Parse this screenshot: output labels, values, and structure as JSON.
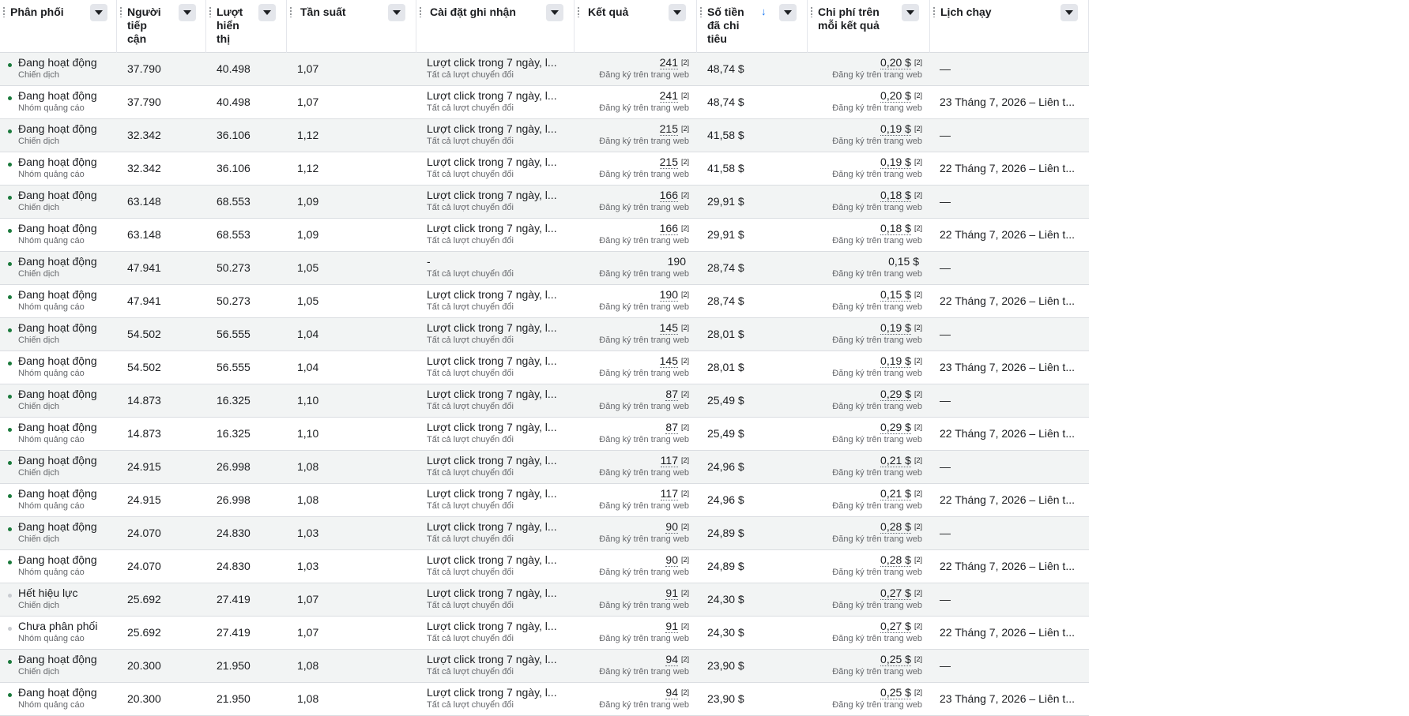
{
  "columns": [
    {
      "key": "status",
      "label": "Phân phối"
    },
    {
      "key": "reach",
      "label": "Người tiếp cận"
    },
    {
      "key": "impressions",
      "label": "Lượt hiển thị"
    },
    {
      "key": "frequency",
      "label": "Tần suất"
    },
    {
      "key": "attribution",
      "label": "Cài đặt ghi nhận"
    },
    {
      "key": "results",
      "label": "Kết quả"
    },
    {
      "key": "spent",
      "label": "Số tiền đã chi tiêu"
    },
    {
      "key": "cost_per_result",
      "label": "Chi phí trên mỗi kết quả"
    },
    {
      "key": "schedule",
      "label": "Lịch chạy"
    }
  ],
  "sort": {
    "column": "spent",
    "direction": "descending"
  },
  "colors": {
    "active_dot": "#1b7a3c",
    "inactive_dot": "#c9ccd1",
    "sort_arrow": "#1877f2",
    "row_alt": "#f2f4f4"
  },
  "rows": [
    {
      "status": "Đang hoạt động",
      "level": "Chiến dịch",
      "active": true,
      "reach": "37.790",
      "impressions": "40.498",
      "frequency": "1,07",
      "attribution": "Lượt click trong 7 ngày, l...",
      "attribution_sub": "Tất cả lượt chuyển đổi",
      "results": "241",
      "results_note": "[2]",
      "results_sub": "Đăng ký trên trang web",
      "spent": "48,74 $",
      "cpr": "0,20 $",
      "cpr_note": "[2]",
      "cpr_sub": "Đăng ký trên trang web",
      "schedule": "—"
    },
    {
      "status": "Đang hoạt động",
      "level": "Nhóm quảng cáo",
      "active": true,
      "reach": "37.790",
      "impressions": "40.498",
      "frequency": "1,07",
      "attribution": "Lượt click trong 7 ngày, l...",
      "attribution_sub": "Tất cả lượt chuyển đổi",
      "results": "241",
      "results_note": "[2]",
      "results_sub": "Đăng ký trên trang web",
      "spent": "48,74 $",
      "cpr": "0,20 $",
      "cpr_note": "[2]",
      "cpr_sub": "Đăng ký trên trang web",
      "schedule": "23 Tháng 7, 2026 – Liên t..."
    },
    {
      "status": "Đang hoạt động",
      "level": "Chiến dịch",
      "active": true,
      "reach": "32.342",
      "impressions": "36.106",
      "frequency": "1,12",
      "attribution": "Lượt click trong 7 ngày, l...",
      "attribution_sub": "Tất cả lượt chuyển đổi",
      "results": "215",
      "results_note": "[2]",
      "results_sub": "Đăng ký trên trang web",
      "spent": "41,58 $",
      "cpr": "0,19 $",
      "cpr_note": "[2]",
      "cpr_sub": "Đăng ký trên trang web",
      "schedule": "—"
    },
    {
      "status": "Đang hoạt động",
      "level": "Nhóm quảng cáo",
      "active": true,
      "reach": "32.342",
      "impressions": "36.106",
      "frequency": "1,12",
      "attribution": "Lượt click trong 7 ngày, l...",
      "attribution_sub": "Tất cả lượt chuyển đổi",
      "results": "215",
      "results_note": "[2]",
      "results_sub": "Đăng ký trên trang web",
      "spent": "41,58 $",
      "cpr": "0,19 $",
      "cpr_note": "[2]",
      "cpr_sub": "Đăng ký trên trang web",
      "schedule": "22 Tháng 7, 2026 – Liên t..."
    },
    {
      "status": "Đang hoạt động",
      "level": "Chiến dịch",
      "active": true,
      "reach": "63.148",
      "impressions": "68.553",
      "frequency": "1,09",
      "attribution": "Lượt click trong 7 ngày, l...",
      "attribution_sub": "Tất cả lượt chuyển đổi",
      "results": "166",
      "results_note": "[2]",
      "results_sub": "Đăng ký trên trang web",
      "spent": "29,91 $",
      "cpr": "0,18 $",
      "cpr_note": "[2]",
      "cpr_sub": "Đăng ký trên trang web",
      "schedule": "—"
    },
    {
      "status": "Đang hoạt động",
      "level": "Nhóm quảng cáo",
      "active": true,
      "reach": "63.148",
      "impressions": "68.553",
      "frequency": "1,09",
      "attribution": "Lượt click trong 7 ngày, l...",
      "attribution_sub": "Tất cả lượt chuyển đổi",
      "results": "166",
      "results_note": "[2]",
      "results_sub": "Đăng ký trên trang web",
      "spent": "29,91 $",
      "cpr": "0,18 $",
      "cpr_note": "[2]",
      "cpr_sub": "Đăng ký trên trang web",
      "schedule": "22 Tháng 7, 2026 – Liên t..."
    },
    {
      "status": "Đang hoạt động",
      "level": "Chiến dịch",
      "active": true,
      "reach": "47.941",
      "impressions": "50.273",
      "frequency": "1,05",
      "attribution": "-",
      "attribution_sub": "Tất cả lượt chuyển đổi",
      "results": "190",
      "results_note": "",
      "results_sub": "Đăng ký trên trang web",
      "spent": "28,74 $",
      "cpr": "0,15 $",
      "cpr_note": "",
      "cpr_sub": "Đăng ký trên trang web",
      "schedule": "—"
    },
    {
      "status": "Đang hoạt động",
      "level": "Nhóm quảng cáo",
      "active": true,
      "reach": "47.941",
      "impressions": "50.273",
      "frequency": "1,05",
      "attribution": "Lượt click trong 7 ngày, l...",
      "attribution_sub": "Tất cả lượt chuyển đổi",
      "results": "190",
      "results_note": "[2]",
      "results_sub": "Đăng ký trên trang web",
      "spent": "28,74 $",
      "cpr": "0,15 $",
      "cpr_note": "[2]",
      "cpr_sub": "Đăng ký trên trang web",
      "schedule": "22 Tháng 7, 2026 – Liên t..."
    },
    {
      "status": "Đang hoạt động",
      "level": "Chiến dịch",
      "active": true,
      "reach": "54.502",
      "impressions": "56.555",
      "frequency": "1,04",
      "attribution": "Lượt click trong 7 ngày, l...",
      "attribution_sub": "Tất cả lượt chuyển đổi",
      "results": "145",
      "results_note": "[2]",
      "results_sub": "Đăng ký trên trang web",
      "spent": "28,01 $",
      "cpr": "0,19 $",
      "cpr_note": "[2]",
      "cpr_sub": "Đăng ký trên trang web",
      "schedule": "—"
    },
    {
      "status": "Đang hoạt động",
      "level": "Nhóm quảng cáo",
      "active": true,
      "reach": "54.502",
      "impressions": "56.555",
      "frequency": "1,04",
      "attribution": "Lượt click trong 7 ngày, l...",
      "attribution_sub": "Tất cả lượt chuyển đổi",
      "results": "145",
      "results_note": "[2]",
      "results_sub": "Đăng ký trên trang web",
      "spent": "28,01 $",
      "cpr": "0,19 $",
      "cpr_note": "[2]",
      "cpr_sub": "Đăng ký trên trang web",
      "schedule": "23 Tháng 7, 2026 – Liên t..."
    },
    {
      "status": "Đang hoạt động",
      "level": "Chiến dịch",
      "active": true,
      "reach": "14.873",
      "impressions": "16.325",
      "frequency": "1,10",
      "attribution": "Lượt click trong 7 ngày, l...",
      "attribution_sub": "Tất cả lượt chuyển đổi",
      "results": "87",
      "results_note": "[2]",
      "results_sub": "Đăng ký trên trang web",
      "spent": "25,49 $",
      "cpr": "0,29 $",
      "cpr_note": "[2]",
      "cpr_sub": "Đăng ký trên trang web",
      "schedule": "—"
    },
    {
      "status": "Đang hoạt động",
      "level": "Nhóm quảng cáo",
      "active": true,
      "reach": "14.873",
      "impressions": "16.325",
      "frequency": "1,10",
      "attribution": "Lượt click trong 7 ngày, l...",
      "attribution_sub": "Tất cả lượt chuyển đổi",
      "results": "87",
      "results_note": "[2]",
      "results_sub": "Đăng ký trên trang web",
      "spent": "25,49 $",
      "cpr": "0,29 $",
      "cpr_note": "[2]",
      "cpr_sub": "Đăng ký trên trang web",
      "schedule": "22 Tháng 7, 2026 – Liên t..."
    },
    {
      "status": "Đang hoạt động",
      "level": "Chiến dịch",
      "active": true,
      "reach": "24.915",
      "impressions": "26.998",
      "frequency": "1,08",
      "attribution": "Lượt click trong 7 ngày, l...",
      "attribution_sub": "Tất cả lượt chuyển đổi",
      "results": "117",
      "results_note": "[2]",
      "results_sub": "Đăng ký trên trang web",
      "spent": "24,96 $",
      "cpr": "0,21 $",
      "cpr_note": "[2]",
      "cpr_sub": "Đăng ký trên trang web",
      "schedule": "—"
    },
    {
      "status": "Đang hoạt động",
      "level": "Nhóm quảng cáo",
      "active": true,
      "reach": "24.915",
      "impressions": "26.998",
      "frequency": "1,08",
      "attribution": "Lượt click trong 7 ngày, l...",
      "attribution_sub": "Tất cả lượt chuyển đổi",
      "results": "117",
      "results_note": "[2]",
      "results_sub": "Đăng ký trên trang web",
      "spent": "24,96 $",
      "cpr": "0,21 $",
      "cpr_note": "[2]",
      "cpr_sub": "Đăng ký trên trang web",
      "schedule": "22 Tháng 7, 2026 – Liên t..."
    },
    {
      "status": "Đang hoạt động",
      "level": "Chiến dịch",
      "active": true,
      "reach": "24.070",
      "impressions": "24.830",
      "frequency": "1,03",
      "attribution": "Lượt click trong 7 ngày, l...",
      "attribution_sub": "Tất cả lượt chuyển đổi",
      "results": "90",
      "results_note": "[2]",
      "results_sub": "Đăng ký trên trang web",
      "spent": "24,89 $",
      "cpr": "0,28 $",
      "cpr_note": "[2]",
      "cpr_sub": "Đăng ký trên trang web",
      "schedule": "—"
    },
    {
      "status": "Đang hoạt động",
      "level": "Nhóm quảng cáo",
      "active": true,
      "reach": "24.070",
      "impressions": "24.830",
      "frequency": "1,03",
      "attribution": "Lượt click trong 7 ngày, l...",
      "attribution_sub": "Tất cả lượt chuyển đổi",
      "results": "90",
      "results_note": "[2]",
      "results_sub": "Đăng ký trên trang web",
      "spent": "24,89 $",
      "cpr": "0,28 $",
      "cpr_note": "[2]",
      "cpr_sub": "Đăng ký trên trang web",
      "schedule": "22 Tháng 7, 2026 – Liên t..."
    },
    {
      "status": "Hết hiệu lực",
      "level": "Chiến dịch",
      "active": false,
      "reach": "25.692",
      "impressions": "27.419",
      "frequency": "1,07",
      "attribution": "Lượt click trong 7 ngày, l...",
      "attribution_sub": "Tất cả lượt chuyển đổi",
      "results": "91",
      "results_note": "[2]",
      "results_sub": "Đăng ký trên trang web",
      "spent": "24,30 $",
      "cpr": "0,27 $",
      "cpr_note": "[2]",
      "cpr_sub": "Đăng ký trên trang web",
      "schedule": "—"
    },
    {
      "status": "Chưa phân phối",
      "level": "Nhóm quảng cáo",
      "active": false,
      "reach": "25.692",
      "impressions": "27.419",
      "frequency": "1,07",
      "attribution": "Lượt click trong 7 ngày, l...",
      "attribution_sub": "Tất cả lượt chuyển đổi",
      "results": "91",
      "results_note": "[2]",
      "results_sub": "Đăng ký trên trang web",
      "spent": "24,30 $",
      "cpr": "0,27 $",
      "cpr_note": "[2]",
      "cpr_sub": "Đăng ký trên trang web",
      "schedule": "22 Tháng 7, 2026 – Liên t..."
    },
    {
      "status": "Đang hoạt động",
      "level": "Chiến dịch",
      "active": true,
      "reach": "20.300",
      "impressions": "21.950",
      "frequency": "1,08",
      "attribution": "Lượt click trong 7 ngày, l...",
      "attribution_sub": "Tất cả lượt chuyển đổi",
      "results": "94",
      "results_note": "[2]",
      "results_sub": "Đăng ký trên trang web",
      "spent": "23,90 $",
      "cpr": "0,25 $",
      "cpr_note": "[2]",
      "cpr_sub": "Đăng ký trên trang web",
      "schedule": "—"
    },
    {
      "status": "Đang hoạt động",
      "level": "Nhóm quảng cáo",
      "active": true,
      "reach": "20.300",
      "impressions": "21.950",
      "frequency": "1,08",
      "attribution": "Lượt click trong 7 ngày, l...",
      "attribution_sub": "Tất cả lượt chuyển đổi",
      "results": "94",
      "results_note": "[2]",
      "results_sub": "Đăng ký trên trang web",
      "spent": "23,90 $",
      "cpr": "0,25 $",
      "cpr_note": "[2]",
      "cpr_sub": "Đăng ký trên trang web",
      "schedule": "23 Tháng 7, 2026 – Liên t..."
    }
  ]
}
